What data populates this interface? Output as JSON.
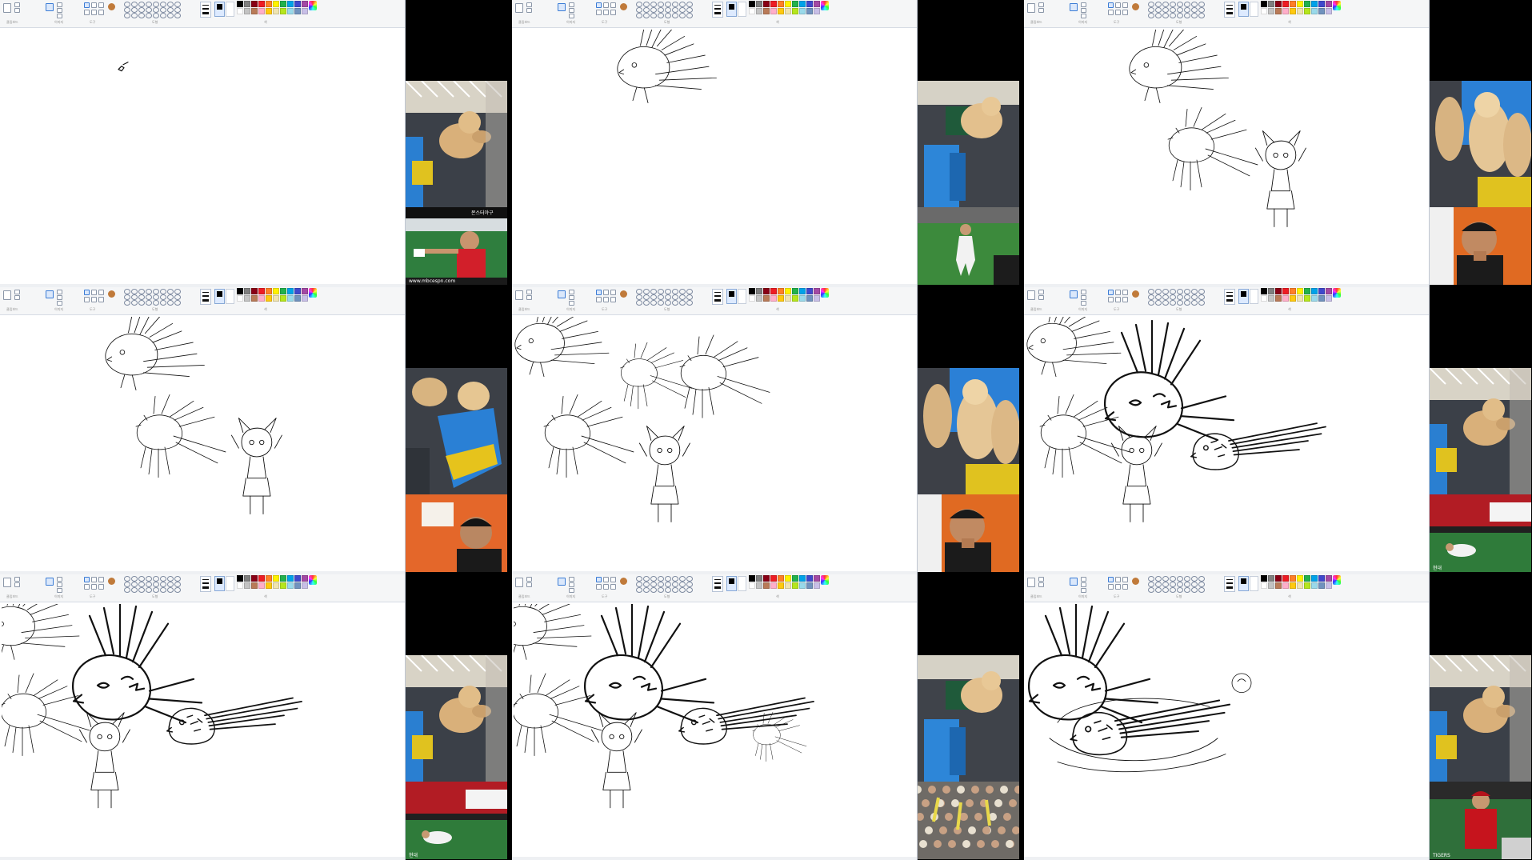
{
  "app": {
    "name": "Paint"
  },
  "ribbon": {
    "groups": [
      "클립보드",
      "이미지",
      "도구",
      "도형",
      "",
      "색"
    ]
  },
  "panels": [
    {
      "id": 1,
      "drawing": "stage1",
      "top_cam": "puppy-slide",
      "bottom_cam": "player-red",
      "caption_top": "몬스터야구",
      "caption_bottom": "www.mbcespn.com"
    },
    {
      "id": 2,
      "drawing": "stage2",
      "top_cam": "puppy-mat",
      "bottom_cam": "player-field",
      "caption_top": "",
      "caption_bottom": ""
    },
    {
      "id": 3,
      "drawing": "stage3",
      "top_cam": "puppies-pair",
      "bottom_cam": "player-laugh",
      "caption_top": "",
      "caption_bottom": ""
    },
    {
      "id": 4,
      "drawing": "stage4",
      "top_cam": "puppies-slide",
      "bottom_cam": "player-office",
      "caption_top": "",
      "caption_bottom": ""
    },
    {
      "id": 5,
      "drawing": "stage5",
      "top_cam": "puppies-pair",
      "bottom_cam": "player-laugh",
      "caption_top": "",
      "caption_bottom": ""
    },
    {
      "id": 6,
      "drawing": "stage6",
      "top_cam": "puppy-slide",
      "bottom_cam": "player-stadium",
      "caption_top": "",
      "caption_bottom": "현대"
    },
    {
      "id": 7,
      "drawing": "stage7",
      "top_cam": "puppy-slide",
      "bottom_cam": "player-stadium",
      "caption_top": "",
      "caption_bottom": "현대"
    },
    {
      "id": 8,
      "drawing": "stage8",
      "top_cam": "puppy-mat",
      "bottom_cam": "crowd",
      "caption_top": "",
      "caption_bottom": ""
    },
    {
      "id": 9,
      "drawing": "stage9",
      "top_cam": "puppy-slide",
      "bottom_cam": "player-tigers",
      "caption_top": "",
      "caption_bottom": "TIGERS"
    }
  ],
  "colors": {
    "palette": [
      "#000000",
      "#7f7f7f",
      "#880015",
      "#ed1c24",
      "#ff7f27",
      "#fff200",
      "#22b14c",
      "#00a2e8",
      "#3f48cc",
      "#a349a4",
      "#ffffff",
      "#c3c3c3",
      "#b97a57",
      "#ffaec9",
      "#ffc90e",
      "#efe4b0",
      "#b5e61d",
      "#99d9ea",
      "#7092be",
      "#c8bfe7"
    ],
    "primary": "#000000",
    "secondary": "#ffffff"
  }
}
